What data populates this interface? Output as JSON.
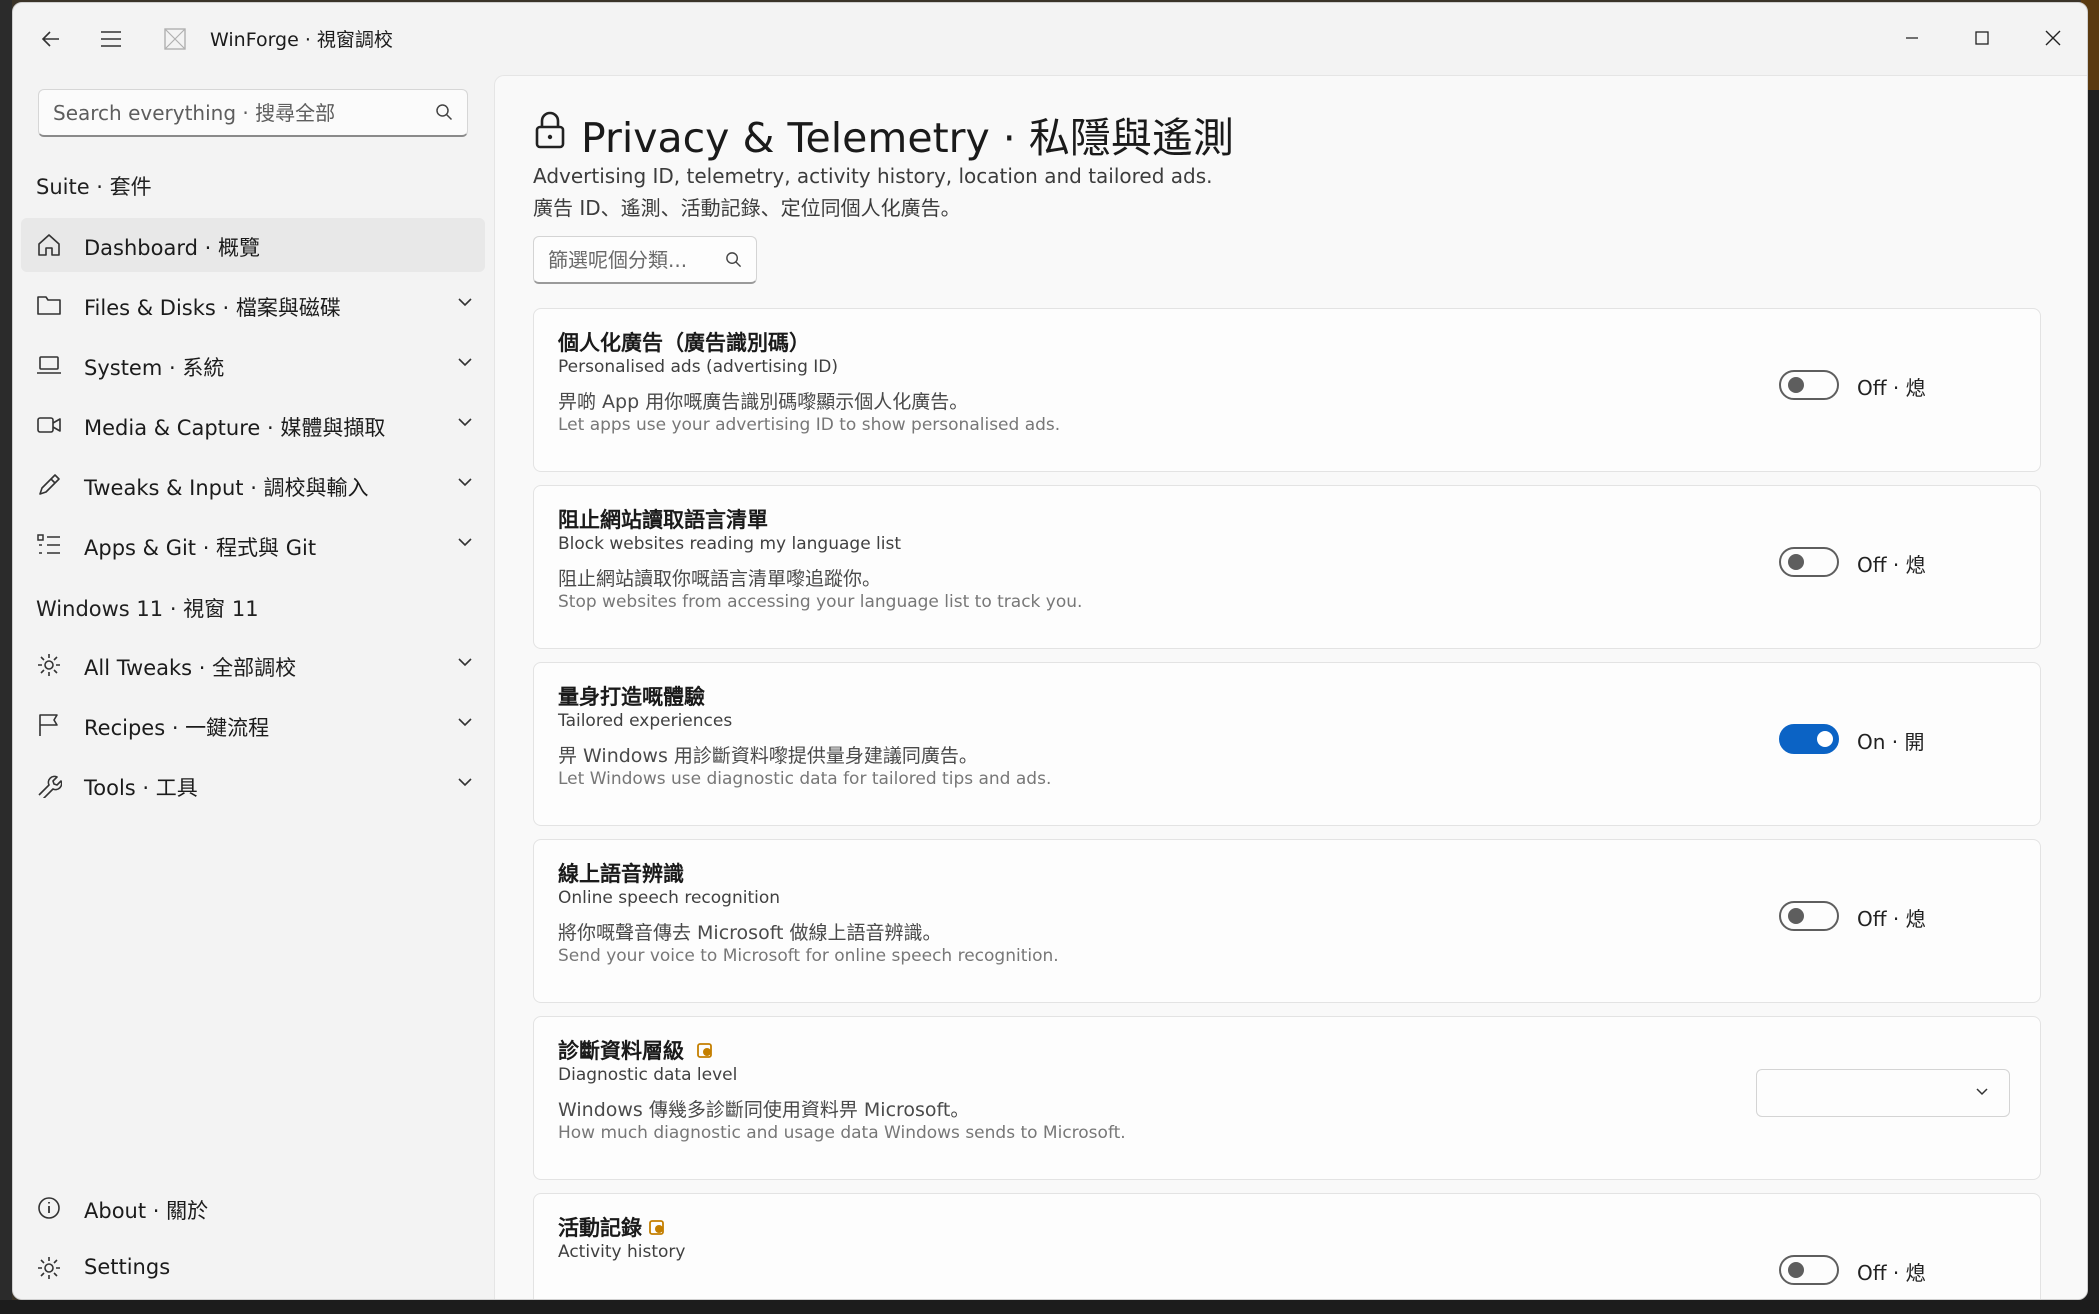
{
  "window": {
    "app_title": "WinForge · 視窗調校"
  },
  "sidebar": {
    "search_placeholder": "Search everything · 搜尋全部",
    "group1_title": "Suite · 套件",
    "group2_title": "Windows 11 · 視窗 11",
    "items": [
      {
        "label": "Dashboard · 概覽",
        "icon": "home-icon"
      },
      {
        "label": "Files & Disks · 檔案與磁碟",
        "icon": "folder-icon"
      },
      {
        "label": "System · 系統",
        "icon": "laptop-icon"
      },
      {
        "label": "Media & Capture · 媒體與擷取",
        "icon": "video-icon"
      },
      {
        "label": "Tweaks & Input · 調校與輸入",
        "icon": "pen-icon"
      },
      {
        "label": "Apps & Git · 程式與 Git",
        "icon": "list-icon"
      },
      {
        "label": "All Tweaks · 全部調校",
        "icon": "gear-icon"
      },
      {
        "label": "Recipes · 一鍵流程",
        "icon": "flag-icon"
      },
      {
        "label": "Tools · 工具",
        "icon": "wrench-icon"
      }
    ],
    "about_label": "About · 關於",
    "settings_label": "Settings"
  },
  "page": {
    "title": "Privacy & Telemetry · 私隱與遙測",
    "description_en": "Advertising ID, telemetry, activity history, location and tailored ads.",
    "description_zh": "廣告 ID、遙測、活動記錄、定位同個人化廣告。",
    "filter_placeholder": "篩選呢個分類..."
  },
  "settings": [
    {
      "title": "個人化廣告（廣告識別碼）",
      "subtitle": "Personalised ads (advertising ID)",
      "desc_zh": "畀啲 App 用你嘅廣告識別碼嚟顯示個人化廣告。",
      "desc_en": "Let apps use your advertising ID to show personalised ads.",
      "control": "toggle",
      "on": false,
      "state_label": "Off · 熄"
    },
    {
      "title": "阻止網站讀取語言清單",
      "subtitle": "Block websites reading my language list",
      "desc_zh": "阻止網站讀取你嘅語言清單嚟追蹤你。",
      "desc_en": "Stop websites from accessing your language list to track you.",
      "control": "toggle",
      "on": false,
      "state_label": "Off · 熄"
    },
    {
      "title": "量身打造嘅體驗",
      "subtitle": "Tailored experiences",
      "desc_zh": "畀 Windows 用診斷資料嚟提供量身建議同廣告。",
      "desc_en": "Let Windows use diagnostic data for tailored tips and ads.",
      "control": "toggle",
      "on": true,
      "state_label": "On · 開"
    },
    {
      "title": "線上語音辨識",
      "subtitle": "Online speech recognition",
      "desc_zh": "將你嘅聲音傳去 Microsoft 做線上語音辨識。",
      "desc_en": "Send your voice to Microsoft for online speech recognition.",
      "control": "toggle",
      "on": false,
      "state_label": "Off · 熄"
    },
    {
      "title": "診斷資料層級",
      "subtitle": "Diagnostic data level",
      "desc_zh": "Windows 傳幾多診斷同使用資料畀 Microsoft。",
      "desc_en": "How much diagnostic and usage data Windows sends to Microsoft.",
      "control": "dropdown",
      "selected": "",
      "badge": "admin-shield-icon"
    },
    {
      "title": "活動記錄",
      "subtitle": "Activity history",
      "control": "toggle",
      "on": false,
      "state_label": "Off · 熄",
      "badge": "admin-shield-icon"
    }
  ],
  "colors": {
    "accent": "#0b63c5",
    "badge": "#c47f00"
  }
}
